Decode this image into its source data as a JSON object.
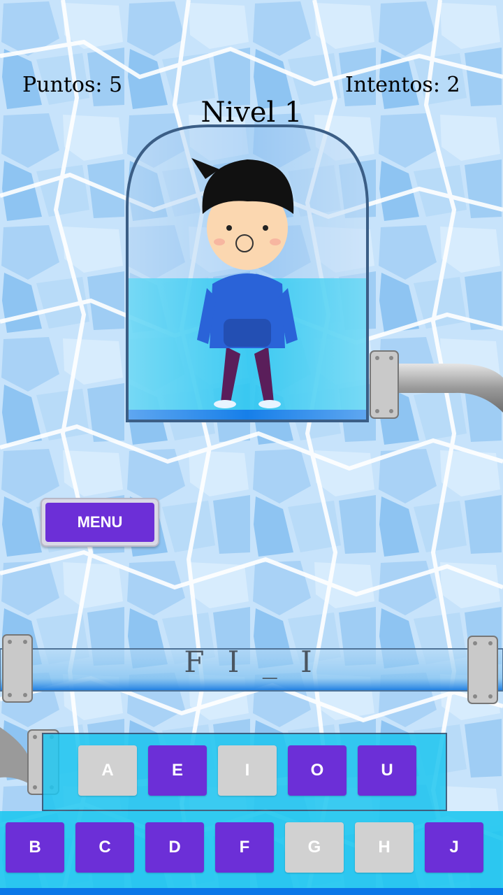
{
  "hud": {
    "score_label": "Puntos: 5",
    "attempts_label": "Intentos: 2",
    "level_label": "Nivel 1"
  },
  "menu": {
    "label": "MENU"
  },
  "word": {
    "display": "F I _ I"
  },
  "keyboard": {
    "vowels": [
      {
        "letter": "A",
        "used": true
      },
      {
        "letter": "E",
        "used": false
      },
      {
        "letter": "I",
        "used": true
      },
      {
        "letter": "O",
        "used": false
      },
      {
        "letter": "U",
        "used": false
      }
    ],
    "consonants": [
      {
        "letter": "B",
        "used": false
      },
      {
        "letter": "C",
        "used": false
      },
      {
        "letter": "D",
        "used": false
      },
      {
        "letter": "F",
        "used": false
      },
      {
        "letter": "G",
        "used": true
      },
      {
        "letter": "H",
        "used": true
      },
      {
        "letter": "J",
        "used": false
      }
    ]
  },
  "colors": {
    "key_active": "#6c2fd7",
    "key_used": "#d1d1d1",
    "water": "#1fc6f0",
    "background": "#bcdcf6"
  }
}
